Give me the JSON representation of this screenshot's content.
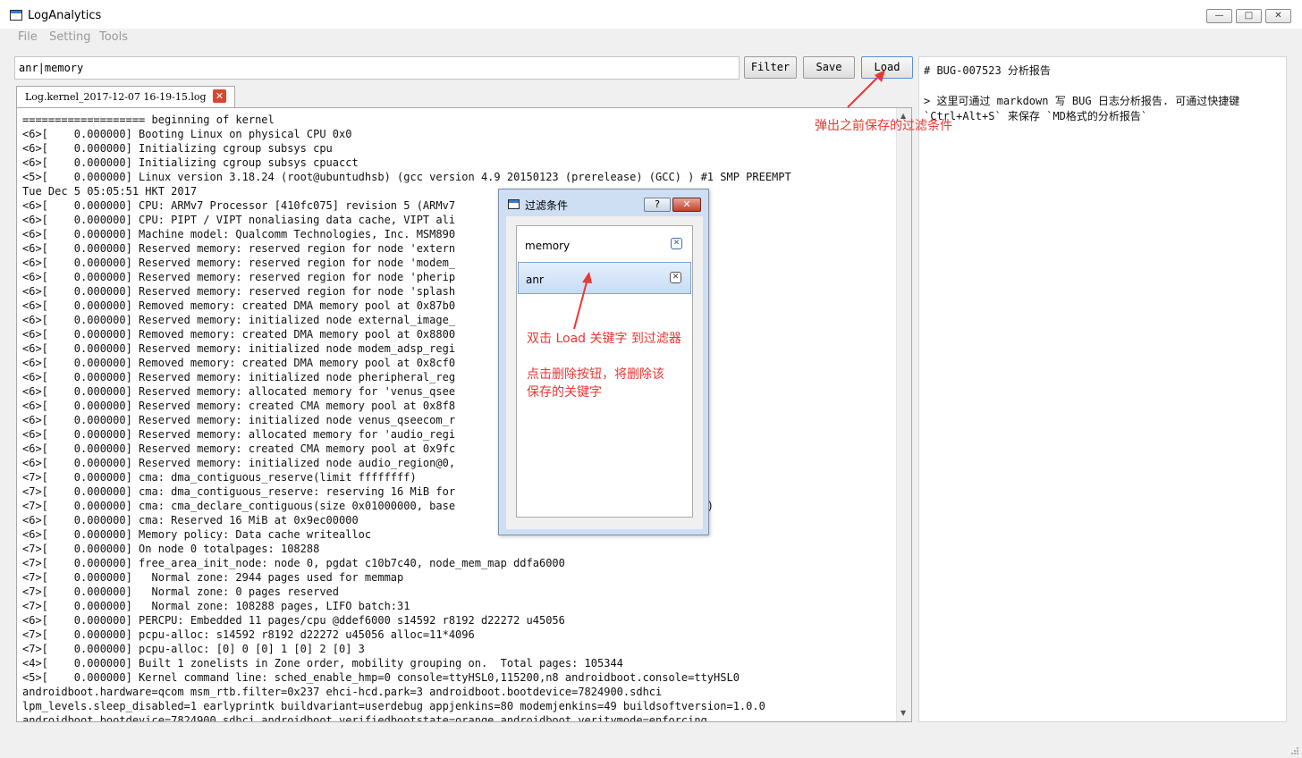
{
  "window": {
    "title": "LogAnalytics",
    "controls": [
      "—",
      "□",
      "✕"
    ]
  },
  "menu": [
    "File",
    "Setting",
    "Tools"
  ],
  "search": {
    "value": "anr|memory"
  },
  "toolbar": {
    "filter": "Filter",
    "save": "Save",
    "load": "Load"
  },
  "tab": {
    "label": "Log.kernel_2017-12-07 16-19-15.log",
    "close": "✕"
  },
  "log_lines": [
    "=================== beginning of kernel",
    "<6>[    0.000000] Booting Linux on physical CPU 0x0",
    "<6>[    0.000000] Initializing cgroup subsys cpu",
    "<6>[    0.000000] Initializing cgroup subsys cpuacct",
    "<5>[    0.000000] Linux version 3.18.24 (root@ubuntudhsb) (gcc version 4.9 20150123 (prerelease) (GCC) ) #1 SMP PREEMPT",
    "Tue Dec 5 05:05:51 HKT 2017",
    "<6>[    0.000000] CPU: ARMv7 Processor [410fc075] revision 5 (ARMv7",
    "<6>[    0.000000] CPU: PIPT / VIPT nonaliasing data cache, VIPT ali",
    "<6>[    0.000000] Machine model: Qualcomm Technologies, Inc. MSM890",
    "<6>[    0.000000] Reserved memory: reserved region for node 'extern                  7b00000, size 5 MiB",
    "<6>[    0.000000] Reserved memory: reserved region for node 'modem_                  00, size 79 MiB",
    "<6>[    0.000000] Reserved memory: reserved region for node 'pherip                  000, size 5 MiB",
    "<6>[    0.000000] Reserved memory: reserved region for node 'splash                  00000, size 12 MiB",
    "<6>[    0.000000] Removed memory: created DMA memory pool at 0x87b0",
    "<6>[    0.000000] Reserved memory: initialized node external_image_                  ved-dma-pool",
    "<6>[    0.000000] Removed memory: created DMA memory pool at 0x8800",
    "<6>[    0.000000] Reserved memory: initialized node modem_adsp_regi                  ma-pool",
    "<6>[    0.000000] Removed memory: created DMA memory pool at 0x8cf0",
    "<6>[    0.000000] Reserved memory: initialized node pheripheral_reg                  dma-pool",
    "<6>[    0.000000] Reserved memory: allocated memory for 'venus_qsee                  800000, size 8 MiB",
    "<6>[    0.000000] Reserved memory: created CMA memory pool at 0x8f8",
    "<6>[    0.000000] Reserved memory: initialized node venus_qseecom_r                  -dma-pool",
    "<6>[    0.000000] Reserved memory: allocated memory for 'audio_regi                  size 4 MiB",
    "<6>[    0.000000] Reserved memory: created CMA memory pool at 0x9fc",
    "<6>[    0.000000] Reserved memory: initialized node audio_region@0,                  1",
    "<7>[    0.000000] cma: dma_contiguous_reserve(limit ffffffff)",
    "<7>[    0.000000] cma: dma_contiguous_reserve: reserving 16 MiB for",
    "<7>[    0.000000] cma: cma_declare_contiguous(size 0x01000000, base                   alignment 0x00000000)",
    "<6>[    0.000000] cma: Reserved 16 MiB at 0x9ec00000",
    "<6>[    0.000000] Memory policy: Data cache writealloc",
    "<7>[    0.000000] On node 0 totalpages: 108288",
    "<7>[    0.000000] free_area_init_node: node 0, pgdat c10b7c40, node_mem_map ddfa6000",
    "<7>[    0.000000]   Normal zone: 2944 pages used for memmap",
    "<7>[    0.000000]   Normal zone: 0 pages reserved",
    "<7>[    0.000000]   Normal zone: 108288 pages, LIFO batch:31",
    "<6>[    0.000000] PERCPU: Embedded 11 pages/cpu @ddef6000 s14592 r8192 d22272 u45056",
    "<7>[    0.000000] pcpu-alloc: s14592 r8192 d22272 u45056 alloc=11*4096",
    "<7>[    0.000000] pcpu-alloc: [0] 0 [0] 1 [0] 2 [0] 3",
    "<4>[    0.000000] Built 1 zonelists in Zone order, mobility grouping on.  Total pages: 105344",
    "<5>[    0.000000] Kernel command line: sched_enable_hmp=0 console=ttyHSL0,115200,n8 androidboot.console=ttyHSL0",
    "androidboot.hardware=qcom msm_rtb.filter=0x237 ehci-hcd.park=3 androidboot.bootdevice=7824900.sdhci",
    "lpm_levels.sleep_disabled=1 earlyprintk buildvariant=userdebug appjenkins=80 modemjenkins=49 buildsoftversion=1.0.0",
    "androidboot.bootdevice=7824900.sdhci androidboot.verifiedbootstate=orange androidboot.veritymode=enforcing"
  ],
  "markdown": {
    "line1": "# BUG-007523 分析报告",
    "line2": "> 这里可通过 markdown 写 BUG 日志分析报告. 可通过快捷键",
    "line3": "`Ctrl+Alt+S` 来保存 `MD格式的分析报告`"
  },
  "dialog": {
    "title": "过滤条件",
    "help": "?",
    "close": "✕",
    "items": [
      {
        "label": "memory",
        "selected": false
      },
      {
        "label": "anr",
        "selected": true
      }
    ],
    "remove_glyph": "✕"
  },
  "annotations": {
    "load_note": "弹出之前保存的过滤条件",
    "dblclick_note": "双击 Load 关键字 到过滤器",
    "delete_note_1": "点击删除按钮，将删除该",
    "delete_note_2": "保存的关键字"
  },
  "colors": {
    "annotation": "#e53935",
    "dialog_frame": "#cfdff3",
    "tab_close": "#d9472f"
  },
  "icons": [
    "app-icon",
    "minimize-icon",
    "maximize-icon",
    "close-icon",
    "tab-close-icon",
    "remove-icon",
    "scroll-up-icon",
    "scroll-down-icon",
    "resize-grip-icon"
  ]
}
